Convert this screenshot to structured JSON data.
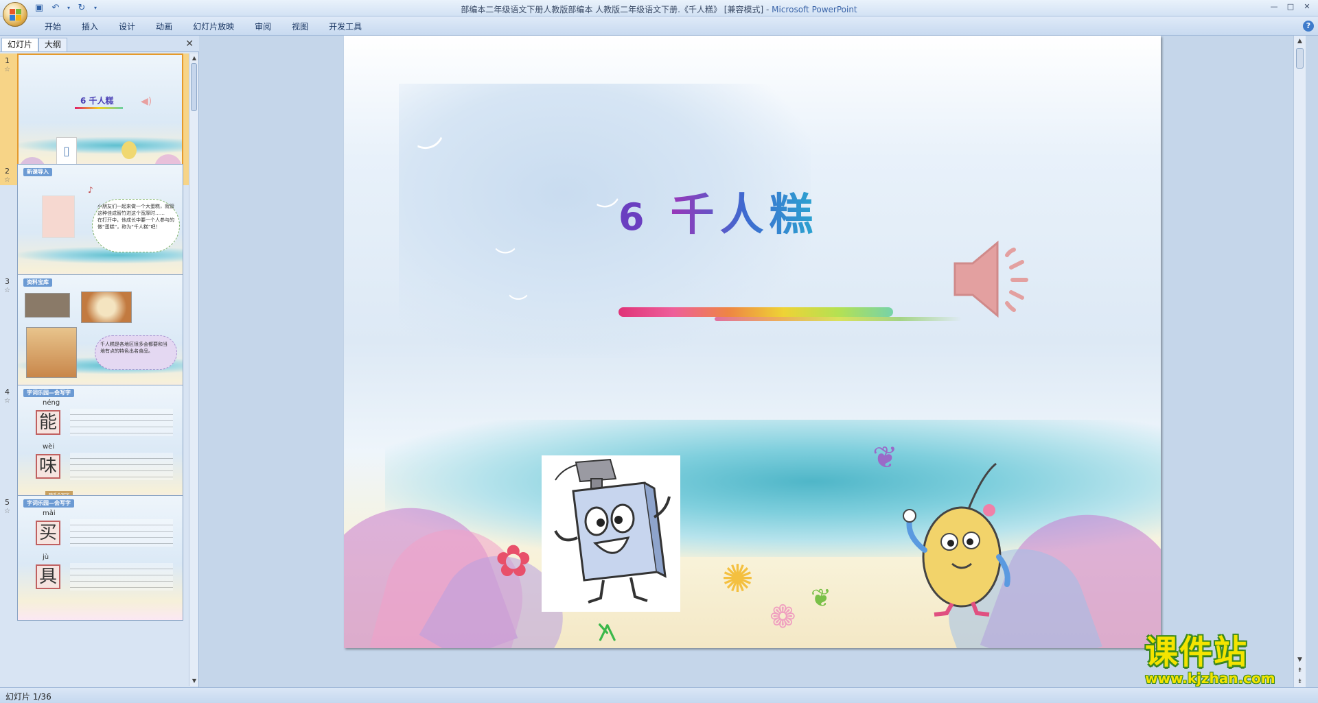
{
  "window": {
    "title": "部编本二年级语文下册人教版部编本 人教版二年级语文下册.《千人糕》 [兼容模式]",
    "app_name": "Microsoft PowerPoint"
  },
  "quick_access": {
    "save_icon": "save-icon",
    "undo_icon": "undo-icon",
    "redo_icon": "redo-icon",
    "customize_icon": "dropdown-icon"
  },
  "ribbon": {
    "tabs": [
      {
        "label": "开始"
      },
      {
        "label": "插入"
      },
      {
        "label": "设计"
      },
      {
        "label": "动画"
      },
      {
        "label": "幻灯片放映"
      },
      {
        "label": "审阅"
      },
      {
        "label": "视图"
      },
      {
        "label": "开发工具"
      }
    ]
  },
  "left_pane": {
    "tabs": [
      {
        "label": "幻灯片",
        "active": true
      },
      {
        "label": "大纲",
        "active": false
      }
    ],
    "thumbnails": [
      {
        "number": "1",
        "title": "6 千人糕"
      },
      {
        "number": "2",
        "header": "新课导入",
        "bubble": "小朋友们一起来做一个大蛋糕，就管这种佳成智竹进这个宽厚时……",
        "bubble2": "在打开中，他成长中要一个人参与的做“蛋糕”，称为“千人糕”吧！"
      },
      {
        "number": "3",
        "header": "资料宝库",
        "bubble": "千人糕是各地区很多会都要和当地有点的特色出名食品。"
      },
      {
        "number": "4",
        "header": "字词乐园—会写字",
        "chars": [
          {
            "pinyin": "néng",
            "char": "能"
          },
          {
            "pinyin": "wèi",
            "char": "味"
          }
        ],
        "button": "随手会写字"
      },
      {
        "number": "5",
        "header": "字词乐园—会写字",
        "chars": [
          {
            "pinyin": "mǎi",
            "char": "买"
          },
          {
            "pinyin": "jù",
            "char": "具"
          }
        ]
      }
    ]
  },
  "slide": {
    "number": "6",
    "title": "千人糕",
    "speaker_icon": "speaker-icon"
  },
  "status": {
    "slide_indicator": "幻灯片 1/36"
  },
  "watermark": {
    "text": "课件站",
    "url": "www.kjzhan.com"
  },
  "colors": {
    "accent": "#3e7bcb",
    "selected_thumb": "#f7d487",
    "title_purple": "#6a3ec0"
  }
}
